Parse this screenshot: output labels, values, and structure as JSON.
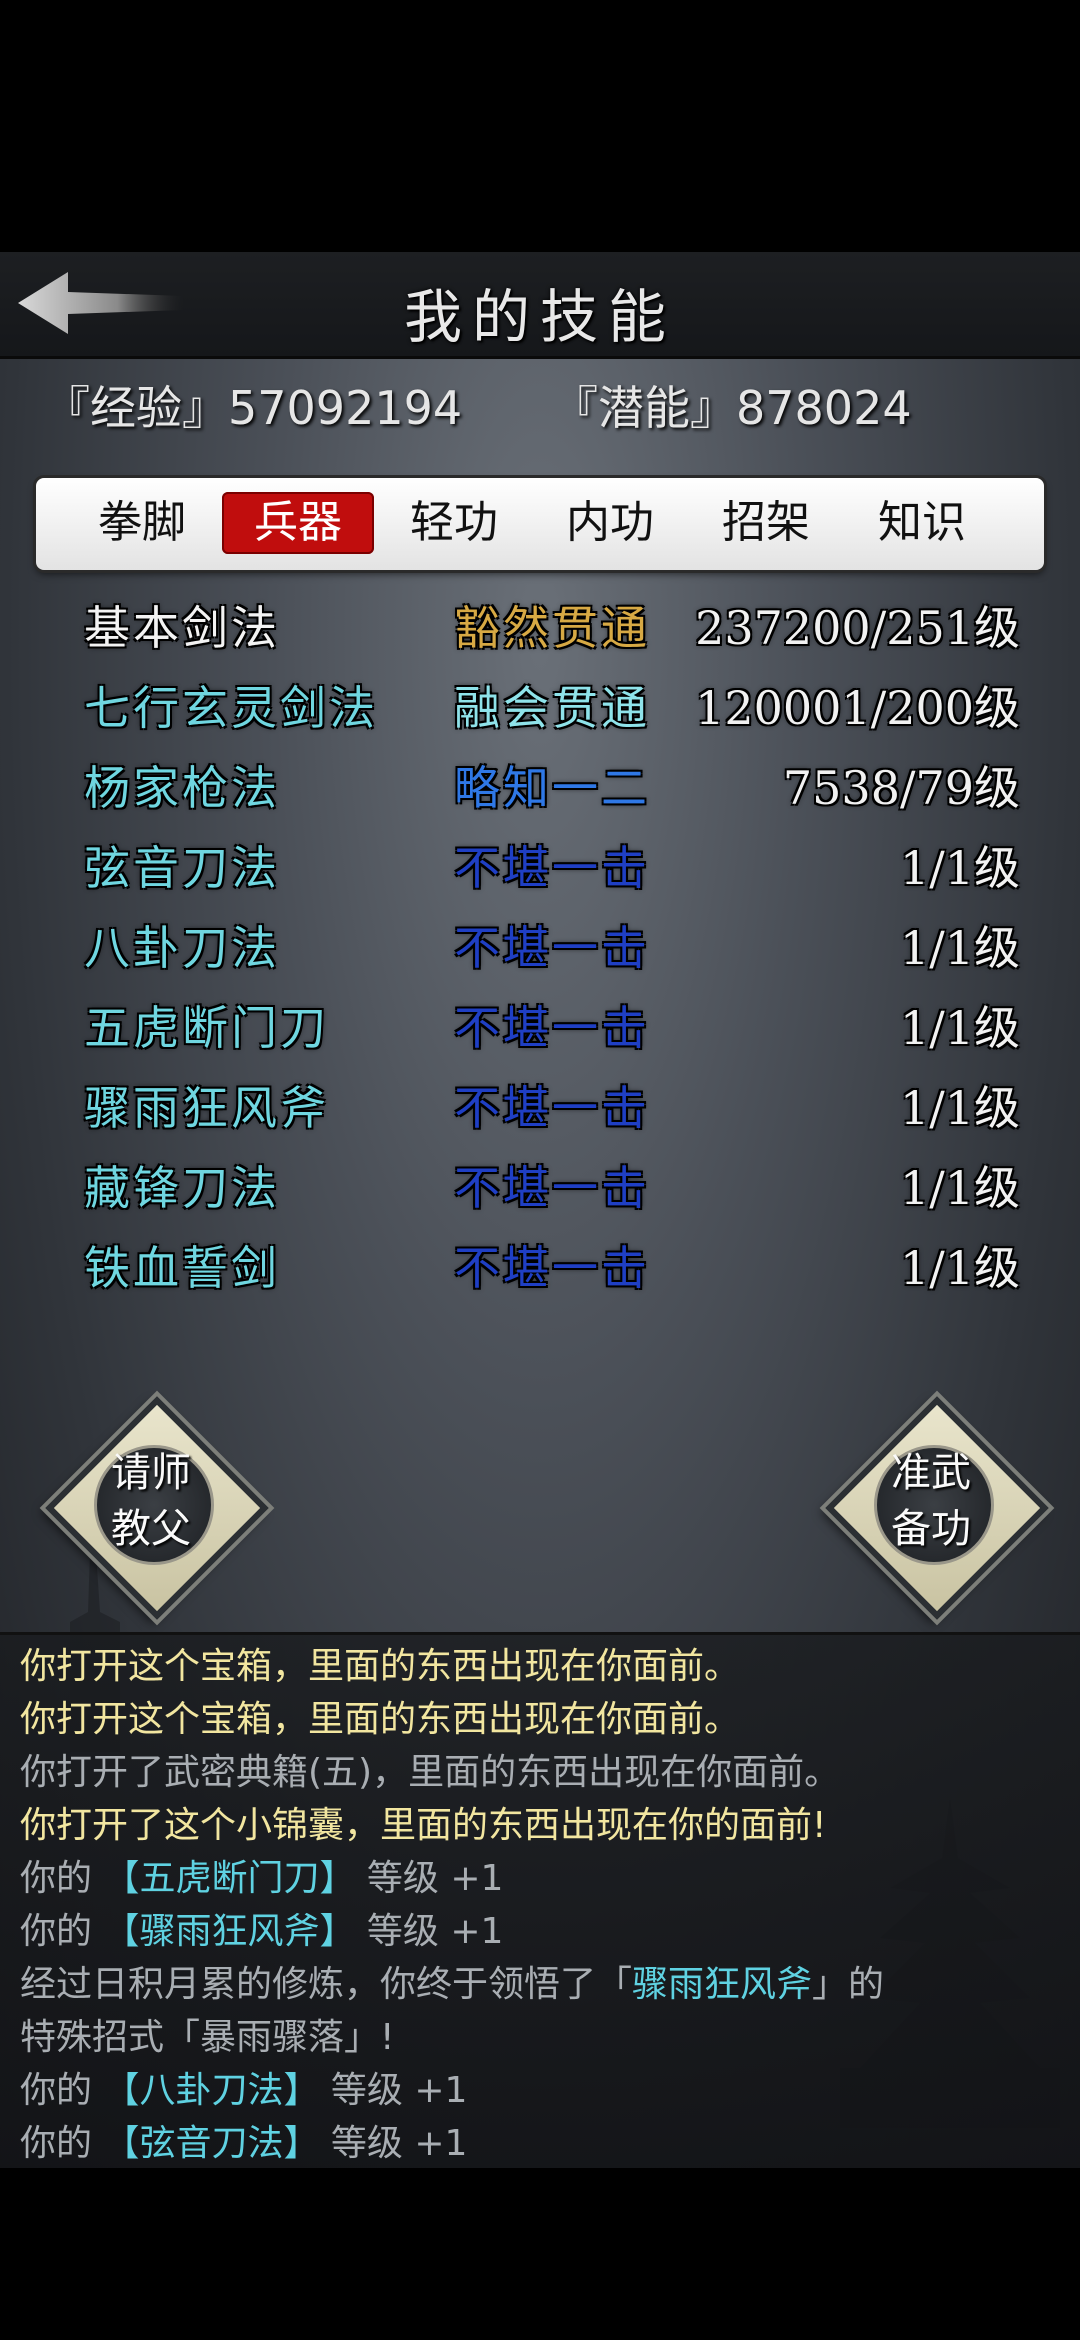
{
  "header": {
    "title": "我的技能"
  },
  "stats": {
    "exp_label": "『经验』",
    "exp_value": "57092194",
    "potential_label": "『潜能』",
    "potential_value": "878024"
  },
  "tabs": [
    {
      "label": "拳脚",
      "active": false
    },
    {
      "label": "兵器",
      "active": true
    },
    {
      "label": "轻功",
      "active": false
    },
    {
      "label": "内功",
      "active": false
    },
    {
      "label": "招架",
      "active": false
    },
    {
      "label": "知识",
      "active": false
    }
  ],
  "skills": [
    {
      "name": "基本剑法",
      "grade": "豁然贯通",
      "level": "237200/251级",
      "name_color": "#f3f3f3",
      "grade_color": "#d7a944"
    },
    {
      "name": "七行玄灵剑法",
      "grade": "融会贯通",
      "level": "120001/200级",
      "name_color": "#6fd6e0",
      "grade_color": "#8fe3ea"
    },
    {
      "name": "杨家枪法",
      "grade": "略知一二",
      "level": "7538/79级",
      "name_color": "#6fd6e0",
      "grade_color": "#2f78e6"
    },
    {
      "name": "弦音刀法",
      "grade": "不堪一击",
      "level": "1/1级",
      "name_color": "#6fd6e0",
      "grade_color": "#1f3fc4"
    },
    {
      "name": "八卦刀法",
      "grade": "不堪一击",
      "level": "1/1级",
      "name_color": "#6fd6e0",
      "grade_color": "#1f3fc4"
    },
    {
      "name": "五虎断门刀",
      "grade": "不堪一击",
      "level": "1/1级",
      "name_color": "#6fd6e0",
      "grade_color": "#1f3fc4"
    },
    {
      "name": "骤雨狂风斧",
      "grade": "不堪一击",
      "level": "1/1级",
      "name_color": "#6fd6e0",
      "grade_color": "#1f3fc4"
    },
    {
      "name": "藏锋刀法",
      "grade": "不堪一击",
      "level": "1/1级",
      "name_color": "#6fd6e0",
      "grade_color": "#1f3fc4"
    },
    {
      "name": "铁血誓剑",
      "grade": "不堪一击",
      "level": "1/1级",
      "name_color": "#6fd6e0",
      "grade_color": "#1f3fc4"
    }
  ],
  "buttons": {
    "master_line1": "请师",
    "master_line2": "教父",
    "prepare_line1": "准武",
    "prepare_line2": "备功"
  },
  "log": [
    [
      {
        "t": "你打开这个宝箱，里面的东西出现在你面前。",
        "c": "#f2e6a0"
      }
    ],
    [
      {
        "t": "你打开这个宝箱，里面的东西出现在你面前。",
        "c": "#f2e6a0"
      }
    ],
    [
      {
        "t": "你打开了武密典籍(五)，里面的东西出现在你面前。",
        "c": "#a9aeb3"
      }
    ],
    [
      {
        "t": "你打开了这个小锦囊，里面的东西出现在你的面前!",
        "c": "#f2e6a0"
      }
    ],
    [
      {
        "t": "你的 ",
        "c": "#a9aeb3"
      },
      {
        "t": "【五虎断门刀】",
        "c": "#5fd2e2"
      },
      {
        "t": " 等级 +1",
        "c": "#a9aeb3"
      }
    ],
    [
      {
        "t": "你的 ",
        "c": "#a9aeb3"
      },
      {
        "t": "【骤雨狂风斧】",
        "c": "#5fd2e2"
      },
      {
        "t": " 等级 +1",
        "c": "#a9aeb3"
      }
    ],
    [
      {
        "t": "经过日积月累的修炼，你终于领悟了「",
        "c": "#a9aeb3"
      },
      {
        "t": "骤雨狂风斧",
        "c": "#5fd2e2"
      },
      {
        "t": "」的",
        "c": "#a9aeb3"
      }
    ],
    [
      {
        "t": "特殊招式「暴雨骤落」!",
        "c": "#a9aeb3"
      }
    ],
    [
      {
        "t": "你的 ",
        "c": "#a9aeb3"
      },
      {
        "t": "【八卦刀法】",
        "c": "#5fd2e2"
      },
      {
        "t": " 等级 +1",
        "c": "#a9aeb3"
      }
    ],
    [
      {
        "t": "你的 ",
        "c": "#a9aeb3"
      },
      {
        "t": "【弦音刀法】",
        "c": "#5fd2e2"
      },
      {
        "t": " 等级 +1",
        "c": "#a9aeb3"
      }
    ]
  ]
}
